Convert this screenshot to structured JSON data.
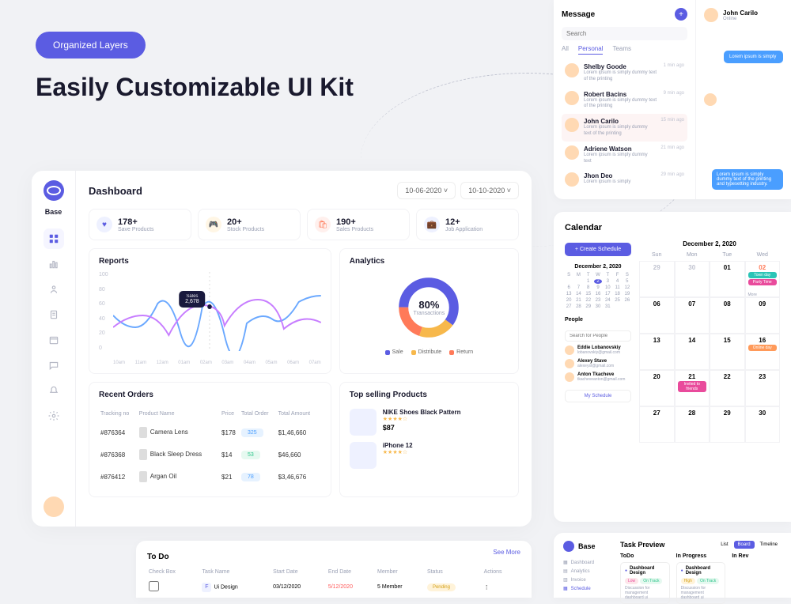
{
  "hero": {
    "badge": "Organized Layers",
    "title": "Easily Customizable UI Kit"
  },
  "dashboard": {
    "title": "Dashboard",
    "brand": "Base",
    "date_from": "10-06-2020",
    "date_to": "10-10-2020",
    "stats": [
      {
        "icon": "♥",
        "value": "178+",
        "label": "Save Products"
      },
      {
        "icon": "🎮",
        "value": "20+",
        "label": "Stock Products"
      },
      {
        "icon": "🛍",
        "value": "190+",
        "label": "Sales Products"
      },
      {
        "icon": "💼",
        "value": "12+",
        "label": "Job Application"
      }
    ],
    "reports_title": "Reports",
    "tooltip_label": "Sales",
    "tooltip_value": "2,678",
    "analytics_title": "Analytics",
    "donut_pct": "80%",
    "donut_label": "Transactions",
    "legend": {
      "sale": "Sale",
      "dist": "Distribute",
      "ret": "Return"
    },
    "orders_title": "Recent Orders",
    "orders_cols": [
      "Tracking no",
      "Product Name",
      "Price",
      "Total Order",
      "Total Amount"
    ],
    "orders": [
      {
        "id": "#876364",
        "name": "Camera Lens",
        "price": "$178",
        "qty": "325",
        "amount": "$1,46,660"
      },
      {
        "id": "#876368",
        "name": "Black Sleep Dress",
        "price": "$14",
        "qty": "53",
        "amount": "$46,660"
      },
      {
        "id": "#876412",
        "name": "Argan Oil",
        "price": "$21",
        "qty": "78",
        "amount": "$3,46,676"
      }
    ],
    "products_title": "Top selling Products",
    "products": [
      {
        "name": "NIKE Shoes Black Pattern",
        "stars": "★★★★☆",
        "price": "$87"
      },
      {
        "name": "iPhone 12",
        "stars": "★★★★☆",
        "price": ""
      }
    ]
  },
  "chart_data": {
    "reports": {
      "type": "line",
      "yticks": [
        "100",
        "80",
        "60",
        "40",
        "20",
        "0"
      ],
      "xticks": [
        "10am",
        "11am",
        "12am",
        "01am",
        "02am",
        "03am",
        "04am",
        "05am",
        "06am",
        "07am"
      ],
      "series": [
        {
          "name": "blue",
          "values": [
            45,
            30,
            60,
            25,
            55,
            20,
            35,
            40,
            62,
            70
          ]
        },
        {
          "name": "pink",
          "values": [
            30,
            45,
            20,
            58,
            32,
            65,
            50,
            28,
            48,
            36
          ]
        }
      ],
      "ylim": [
        0,
        100
      ]
    },
    "analytics": {
      "type": "pie",
      "title": "Transactions",
      "center": "80%",
      "slices": [
        {
          "name": "Sale",
          "value": 60,
          "color": "#5b5ce2"
        },
        {
          "name": "Distribute",
          "value": 20,
          "color": "#f7b84b"
        },
        {
          "name": "Return",
          "value": 20,
          "color": "#ff7a59"
        }
      ]
    }
  },
  "messages": {
    "title": "Message",
    "search_ph": "Search",
    "tabs": [
      "All",
      "Personal",
      "Teams"
    ],
    "items": [
      {
        "name": "Shelby Goode",
        "text": "Lorem ipsum is simply dummy text of the printing",
        "time": "1 min ago"
      },
      {
        "name": "Robert Bacins",
        "text": "Lorem ipsum is simply dummy text of the printing",
        "time": "9 min ago"
      },
      {
        "name": "John Carilo",
        "text": "Lorem ipsum is simply dummy text of the printing",
        "time": "15 min ago"
      },
      {
        "name": "Adriene Watson",
        "text": "Lorem ipsum is simply dummy text",
        "time": "21 min ago"
      },
      {
        "name": "Jhon Deo",
        "text": "Lorem ipsum is simply",
        "time": "29 min ago"
      }
    ],
    "chat_name": "John Carilo",
    "chat_status": "Online",
    "bubble1": "Lorem ipsum is simply",
    "bubble2": "Lorem ipsum is simply dummy text of the printing and typesetting industry."
  },
  "calendar": {
    "title": "Calendar",
    "create": "+  Create Schedule",
    "month": "December 2, 2020",
    "weekdays": [
      "Sun",
      "Mon",
      "Tue",
      "Wed"
    ],
    "big_month": "December 2, 2020",
    "people_title": "People",
    "people_search": "Search for People",
    "people": [
      {
        "name": "Eddie Lobanovskiy",
        "email": "lobanovskiy@gmail.com"
      },
      {
        "name": "Alexey Stave",
        "email": "alexeyst@gmail.com"
      },
      {
        "name": "Anton Tkacheve",
        "email": "tkacheveanton@gmail.com"
      }
    ],
    "my_schedule": "My Schedule",
    "more": "More",
    "events": {
      "townday": "Town day",
      "party": "Party Time",
      "invited": "Invited to friends",
      "online": "Online day"
    }
  },
  "todo": {
    "title": "To Do",
    "seemore": "See More",
    "cols": [
      "Check Box",
      "Task Name",
      "Start Date",
      "End Date",
      "Member",
      "Status",
      "Actions"
    ],
    "row": {
      "letter": "F",
      "name": "Ui Design",
      "start": "03/12/2020",
      "end": "5/12/2020",
      "member": "5 Member",
      "status": "Pending"
    }
  },
  "taskprev": {
    "brand": "Base",
    "title": "Task Preview",
    "nav": [
      "Dashboard",
      "Analytics",
      "Invoice",
      "Schedule"
    ],
    "tabs": [
      "List",
      "Board",
      "Timeline"
    ],
    "cols": [
      "ToDo",
      "In Progress",
      "In Rev"
    ],
    "card_title": "Dashboard Design",
    "low": "Low",
    "high": "High",
    "ontrack": "On Track",
    "desc": "Discussion for management dashboard ui"
  }
}
